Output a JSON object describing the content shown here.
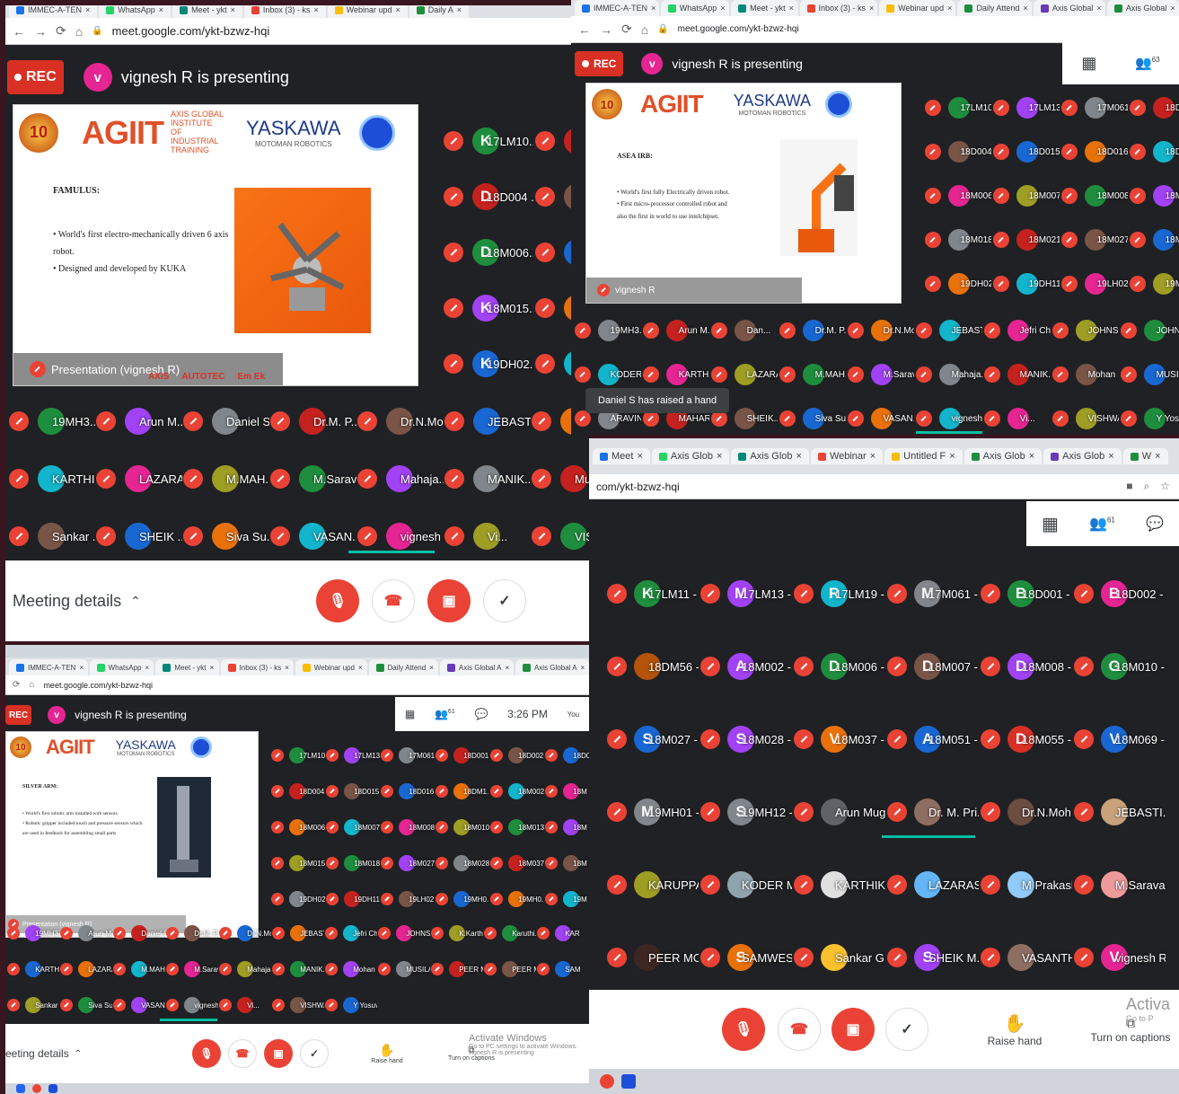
{
  "colors": {
    "rec": "#d93025",
    "mute": "#ea4335",
    "meet_bg": "#202124",
    "active": "#00bfa5"
  },
  "presenter": {
    "initial": "v",
    "text": "vignesh R is presenting"
  },
  "rec_label": "REC",
  "url": "meet.google.com/ykt-bzwz-hqi",
  "url_short": "com/ykt-bzwz-hqi",
  "panel_a": {
    "tabs": [
      "IMMEC-A-TEN",
      "WhatsApp",
      "Meet - ykt",
      "Inbox (3) - ks",
      "Webinar upd",
      "Daily A"
    ],
    "slide": {
      "medal": "10",
      "brand": "AGIIT",
      "brand_sub": "AXIS GLOBAL INSTITUTE OF INDUSTRIAL TRAINING",
      "yaskawa": "YASKAWA",
      "yaskawa_sub": "MOTOMAN ROBOTICS",
      "heading": "FAMULUS:",
      "bullets": [
        "• World's first electro-mechanically driven 6 axis robot.",
        "• Designed and developed by KUKA"
      ],
      "caption": "Presentation (vignesh R)",
      "sponsor1": "AXIS",
      "sponsor2": "AUTOTEC",
      "sponsor3": "Em Ek"
    },
    "side_tiles": [
      {
        "i": "K",
        "c": "#1e8e3e",
        "n": "17LM10..."
      },
      {
        "i": "D",
        "c": "#c5221f",
        "n": "18D004 ..."
      },
      {
        "i": "D",
        "c": "#1e8e3e",
        "n": "18M006..."
      },
      {
        "i": "K",
        "c": "#a142f4",
        "n": "18M015..."
      },
      {
        "i": "K",
        "c": "#1967d2",
        "n": "19DH02..."
      }
    ],
    "rows": [
      [
        "19MH3...",
        "Arun M...",
        "Daniel S",
        "Dr.M. P...",
        "Dr.N.Mo...",
        "JEBAST...",
        "Jef"
      ],
      [
        "KARTHIK",
        "LAZARA...",
        "M.MAH...",
        "M.Sarav...",
        "Mahaja...",
        "MANIK...",
        "Mu"
      ],
      [
        "Sankar ...",
        "SHEIK ...",
        "Siva Su...",
        "VASAN...",
        "vignesh R",
        "Vi...",
        "VISHW"
      ]
    ],
    "meeting_details": "Meeting details"
  },
  "panel_b": {
    "tabs": [
      "IMMEC-A-TEN",
      "WhatsApp",
      "Meet - ykt",
      "Inbox (3) - ks",
      "Webinar upd",
      "Daily Attend",
      "Axis Global",
      "Axis Global"
    ],
    "participants_count": "63",
    "slide": {
      "medal": "10",
      "brand": "AGIIT",
      "yaskawa": "YASKAWA",
      "yaskawa_sub": "MOTOMAN ROBOTICS",
      "heading": "ASEA IRB:",
      "bullets": [
        "• World's first fully Electrically driven robot.",
        "• First micro-processor controlled robot and",
        "also the first in world to use intelchipset."
      ],
      "caption": "vignesh R"
    },
    "cols": [
      [
        "17LM10...",
        "18D004 ...",
        "18M006...",
        "18M018...",
        "19DH02..."
      ],
      [
        "17LM13...",
        "18D015 ...",
        "18M007...",
        "18M021...",
        "19DH11..."
      ],
      [
        "17M061...",
        "18D016 ...",
        "18M008...",
        "18M027...",
        "19LH02..."
      ],
      [
        "18D00",
        "18DM1",
        "18M01",
        "18M02",
        "19MH"
      ]
    ],
    "rows": [
      [
        "19MH3...",
        "Arun M...",
        "Dan...",
        "Dr.M. P...",
        "Dr.N.Mo...",
        "JEBAST...",
        "Jefri Ch...",
        "JOHNS...",
        "JOHNS"
      ],
      [
        "KODER ...",
        "KARTHIK",
        "LAZARA...",
        "M.MAH...",
        "M.Sarav...",
        "Mahaja...",
        "MANIK...",
        "Mohan ...",
        "MUSIL"
      ],
      [
        "ARAVIND...",
        "MAHAR...",
        "SHEIK...",
        "Siva Su...",
        "VASAN...",
        "vignesh R",
        "Vi...",
        "VISHWA...",
        "Y Yosu"
      ]
    ],
    "toast": "Daniel S has raised a hand"
  },
  "panel_c": {
    "tabs": [
      "IMMEC-A-TEN",
      "WhatsApp",
      "Meet - ykt",
      "Inbox (3) - ks",
      "Webinar upd",
      "Daily Attend",
      "Axis Global A",
      "Axis Global A"
    ],
    "url": "meet.google.com/ykt-bzwz-hqi",
    "participants_count": "61",
    "time": "3:26 PM",
    "you": "You",
    "slide": {
      "medal": "10",
      "brand": "AGIIT",
      "yaskawa": "YASKAWA",
      "yaskawa_sub": "MOTOMAN ROBOTICS",
      "heading": "SILVER ARM:",
      "bullets": [
        "• World's first robotic arm installed with sensors",
        "• Robotic gripper included touch and pressure sensors which are used in feedback for assembling small parts"
      ],
      "caption": "Presentation (vignesh R)"
    },
    "cols": [
      [
        "17LM10...",
        "18D004 ...",
        "18M006...",
        "18M015...",
        "19DH02..."
      ],
      [
        "17LM13...",
        "18D015 ...",
        "18M007...",
        "18M018...",
        "19DH11..."
      ],
      [
        "17M061...",
        "18D016 ...",
        "18M008...",
        "18M027...",
        "19LH02..."
      ],
      [
        "18D001 ...",
        "18DM1...",
        "18M010...",
        "18M028...",
        "19MH0..."
      ],
      [
        "18D002 ...",
        "18M002...",
        "18M013...",
        "18M037...",
        "19MH0..."
      ],
      [
        "18D0",
        "18M",
        "18M",
        "18M",
        "19M"
      ]
    ],
    "rows": [
      [
        "19MH3...",
        "Arun M...",
        "Daniel S",
        "Dr.M. P...",
        "Dr.N.Mo...",
        "JEBAST...",
        "Jefri Ch...",
        "JOHNS...",
        "K.Karth...",
        "Karuthi...",
        "KAR"
      ],
      [
        "KARTHIK",
        "LAZARA...",
        "M.MAH...",
        "M.Sarav...",
        "Mahaja...",
        "MANIK...",
        "Mohan ...",
        "MUSILA...",
        "PEER MO...",
        "PEER M...",
        "SAM"
      ],
      [
        "Sankar ...",
        "Siva Su...",
        "VASAN...",
        "vignesh R",
        "Vi...",
        "VISHWA...",
        "Y Yosuva"
      ]
    ],
    "meeting_details": "eeting details",
    "raise_hand": "Raise hand",
    "captions": "Turn on captions",
    "activate": "Activate Windows",
    "activate_sub": "Go to PC settings to activate Windows.",
    "presenting_note": "vignesh R is presenting"
  },
  "panel_d": {
    "tabs": [
      "Meet",
      "Axis Glob",
      "Axis Glob",
      "Webinar",
      "Untitled F",
      "Axis Glob",
      "Axis Glob",
      "W"
    ],
    "url": "com/ykt-bzwz-hqi",
    "participants_count": "61",
    "rows": [
      [
        {
          "i": "K",
          "c": "#1e8e3e",
          "n": "17LM11 - ..."
        },
        {
          "i": "M",
          "c": "#a142f4",
          "n": "17LM13 - ..."
        },
        {
          "i": "R",
          "c": "#12b5cb",
          "n": "17LM19 - ..."
        },
        {
          "i": "M",
          "c": "#80868b",
          "n": "17M061 - ..."
        },
        {
          "i": "B",
          "c": "#1e8e3e",
          "n": "18D001 - ..."
        },
        {
          "i": "B",
          "c": "#e52592",
          "n": "18D002 - ..."
        }
      ],
      [
        {
          "i": "",
          "c": "#b45309",
          "n": "18DM56 - ..."
        },
        {
          "i": "A",
          "c": "#a142f4",
          "n": "18M002 - ..."
        },
        {
          "i": "D",
          "c": "#1e8e3e",
          "n": "18M006 - ..."
        },
        {
          "i": "D",
          "c": "#795548",
          "n": "18M007 - ..."
        },
        {
          "i": "D",
          "c": "#a142f4",
          "n": "18M008 - ..."
        },
        {
          "i": "G",
          "c": "#1e8e3e",
          "n": "18M010 - ..."
        }
      ],
      [
        {
          "i": "S",
          "c": "#1967d2",
          "n": "18M027 - ..."
        },
        {
          "i": "S",
          "c": "#a142f4",
          "n": "18M028 - ..."
        },
        {
          "i": "V",
          "c": "#e8710a",
          "n": "18M037 - ..."
        },
        {
          "i": "A",
          "c": "#1967d2",
          "n": "18M051 - ..."
        },
        {
          "i": "D",
          "c": "#d93025",
          "n": "18M055 - ..."
        },
        {
          "i": "V",
          "c": "#1967d2",
          "n": "18M069 - ..."
        }
      ],
      [
        {
          "i": "M",
          "c": "#80868b",
          "n": "19MH01 - ..."
        },
        {
          "i": "S",
          "c": "#80868b",
          "n": "19MH12 - ..."
        },
        {
          "i": "",
          "c": "#5f6368",
          "n": "Arun Mug..."
        },
        {
          "i": "",
          "c": "#8d6e63",
          "n": "Dr. M. Pri..."
        },
        {
          "i": "",
          "c": "#6d4c41",
          "n": "Dr.N.Moh..."
        },
        {
          "i": "",
          "c": "#c8a27a",
          "n": "JEBASTI..."
        }
      ],
      [
        {
          "i": "",
          "c": "#9e9d24",
          "n": "KARUPPA..."
        },
        {
          "i": "",
          "c": "#90a4ae",
          "n": "KODER M..."
        },
        {
          "i": "",
          "c": "#e0e0e0",
          "n": "KARTHIK"
        },
        {
          "i": "",
          "c": "#64b5f6",
          "n": "LAZARAS J"
        },
        {
          "i": "",
          "c": "#90caf9",
          "n": "M Prakash"
        },
        {
          "i": "",
          "c": "#ef9a9a",
          "n": "M.Sarava..."
        }
      ],
      [
        {
          "i": "",
          "c": "#3e2723",
          "n": "PEER MO..."
        },
        {
          "i": "S",
          "c": "#e8710a",
          "n": "SAMWES..."
        },
        {
          "i": "",
          "c": "#fbc02d",
          "n": "Sankar G..."
        },
        {
          "i": "S",
          "c": "#a142f4",
          "n": "SHEIK M..."
        },
        {
          "i": "",
          "c": "#8d6e63",
          "n": "VASANTH..."
        },
        {
          "i": "V",
          "c": "#e52592",
          "n": "vignesh R"
        }
      ]
    ],
    "raise_hand": "Raise hand",
    "captions": "Turn on captions",
    "activate": "Activa",
    "activate_sub": "Go to P"
  }
}
